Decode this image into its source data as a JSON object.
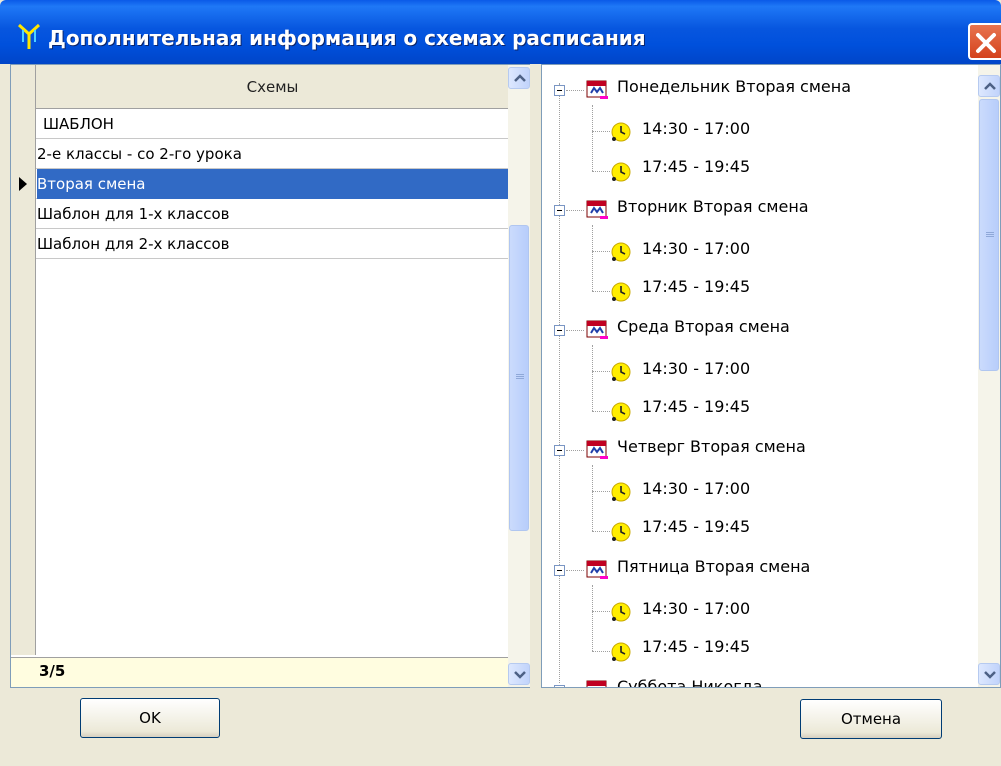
{
  "window": {
    "title": "Дополнительная информация о схемах расписания"
  },
  "schemes_grid": {
    "column_header": "Схемы",
    "rows": [
      {
        "label": " ШАБЛОН"
      },
      {
        "label": "2-е классы - со 2-го урока"
      },
      {
        "label": "Вторая смена",
        "selected": true
      },
      {
        "label": "Шаблон для 1-х классов"
      },
      {
        "label": "Шаблон для 2-х классов"
      }
    ],
    "record_counter": "3/5"
  },
  "schedule_tree": {
    "days": [
      {
        "label": "Понедельник Вторая смена",
        "intervals": [
          "14:30 - 17:00",
          "17:45 - 19:45"
        ]
      },
      {
        "label": "Вторник Вторая смена",
        "intervals": [
          "14:30 - 17:00",
          "17:45 - 19:45"
        ]
      },
      {
        "label": "Среда Вторая смена",
        "intervals": [
          "14:30 - 17:00",
          "17:45 - 19:45"
        ]
      },
      {
        "label": "Четверг Вторая смена",
        "intervals": [
          "14:30 - 17:00",
          "17:45 - 19:45"
        ]
      },
      {
        "label": "Пятница Вторая смена",
        "intervals": [
          "14:30 - 17:00",
          "17:45 - 19:45"
        ]
      },
      {
        "label": "Суббота Никогда",
        "intervals": []
      }
    ]
  },
  "buttons": {
    "ok_label": "OK",
    "cancel_label": "Отмена"
  },
  "colors": {
    "titlebar": "#0756df",
    "selection": "#316ac5",
    "counter_bg": "#fffde0",
    "close_button": "#d4421c"
  },
  "icons": {
    "title": "turnstile-icon",
    "close": "close-icon",
    "day": "calendar-icon",
    "interval": "clock-icon",
    "expander": "collapse-minus-icon"
  }
}
